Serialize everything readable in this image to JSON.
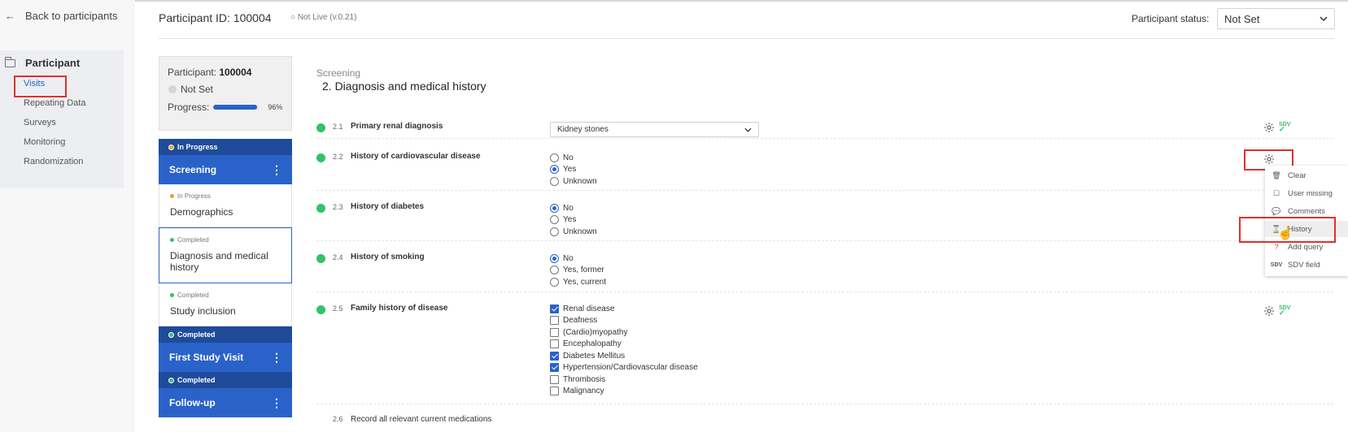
{
  "nav": {
    "back_label": "Back to participants",
    "section_title": "Participant",
    "items": [
      "Visits",
      "Repeating Data",
      "Surveys",
      "Monitoring",
      "Randomization"
    ]
  },
  "header": {
    "participant_id": "Participant ID: 100004",
    "live_status": "○ Not Live (v.0.21)",
    "status_label": "Participant status:",
    "status_value": "Not Set"
  },
  "participant_card": {
    "participant_label": "Participant: ",
    "participant_id": "100004",
    "status": "Not Set",
    "progress_label": "Progress:",
    "progress_pct": "96%",
    "progress_value": 0.96
  },
  "visits": [
    {
      "status": "In Progress",
      "name": "Screening",
      "forms": [
        {
          "status": "In Progress",
          "name": "Demographics"
        },
        {
          "status": "Completed",
          "name": "Diagnosis and medical history"
        },
        {
          "status": "Completed",
          "name": "Study inclusion"
        }
      ]
    },
    {
      "status": "Completed",
      "name": "First Study Visit"
    },
    {
      "status": "Completed",
      "name": "Follow-up"
    }
  ],
  "form": {
    "section": "Screening",
    "title": "2. Diagnosis and medical history",
    "questions": [
      {
        "num": "2.1",
        "label": "Primary renal diagnosis",
        "value": "Kidney stones"
      },
      {
        "num": "2.2",
        "label": "History of cardiovascular disease",
        "options": [
          "No",
          "Yes",
          "Unknown"
        ]
      },
      {
        "num": "2.3",
        "label": "History of diabetes",
        "options": [
          "No",
          "Yes",
          "Unknown"
        ]
      },
      {
        "num": "2.4",
        "label": "History of smoking",
        "options": [
          "No",
          "Yes, former",
          "Yes, current"
        ]
      },
      {
        "num": "2.5",
        "label": "Family history of disease",
        "options": [
          "Renal disease",
          "Deafness",
          "(Cardio)myopathy",
          "Encephalopathy",
          "Diabetes Mellitus",
          "Hypertension/Cardiovascular disease",
          "Thrombosis",
          "Malignancy"
        ]
      },
      {
        "num": "2.6",
        "label": "Record all relevant current medications"
      }
    ]
  },
  "sdv_label": "SDV",
  "context_menu": {
    "items": [
      "Clear",
      "User missing",
      "Comments",
      "History",
      "Add query",
      "SDV field"
    ]
  }
}
